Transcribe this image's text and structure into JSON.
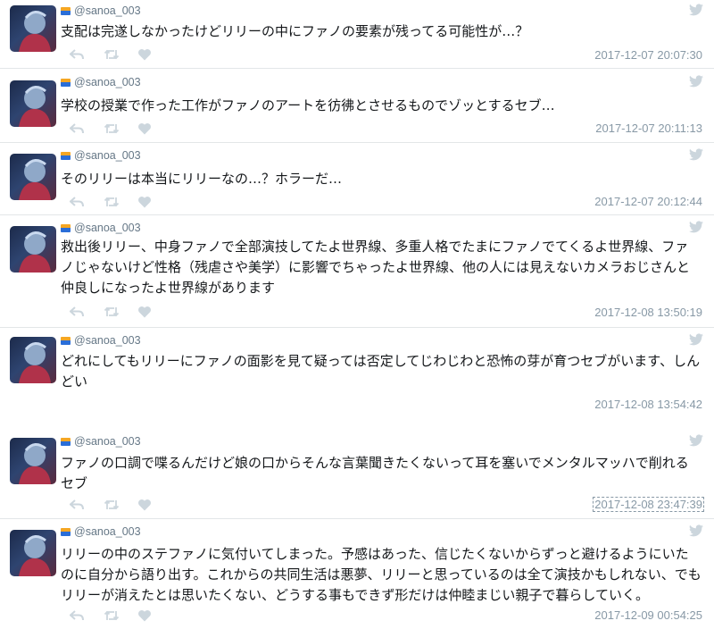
{
  "tweets": [
    {
      "handle": "@sanoa_003",
      "text": "支配は完遂しなかったけどリリーの中にファノの要素が残ってる可能性が…？",
      "timestamp": "2017-12-07 20:07:30"
    },
    {
      "handle": "@sanoa_003",
      "text": "学校の授業で作った工作がファノのアートを彷彿とさせるものでゾッとするセブ…",
      "timestamp": "2017-12-07 20:11:13"
    },
    {
      "handle": "@sanoa_003",
      "text": "そのリリーは本当にリリーなの…？ホラーだ…",
      "timestamp": "2017-12-07 20:12:44"
    },
    {
      "handle": "@sanoa_003",
      "text": "救出後リリー、中身ファノで全部演技してたよ世界線、多重人格でたまにファノでてくるよ世界線、ファノじゃないけど性格（残虐さや美学）に影響でちゃったよ世界線、他の人には見えないカメラおじさんと仲良しになったよ世界線があります",
      "timestamp": "2017-12-08 13:50:19"
    },
    {
      "handle": "@sanoa_003",
      "text": "どれにしてもリリーにファノの面影を見て疑っては否定してじわじわと恐怖の芽が育つセブがいます、しんどい",
      "timestamp": "2017-12-08 13:54:42"
    },
    {
      "handle": "@sanoa_003",
      "text": "ファノの口調で喋るんだけど娘の口からそんな言葉聞きたくないって耳を塞いでメンタルマッハで削れるセブ",
      "timestamp": "2017-12-08 23:47:39"
    },
    {
      "handle": "@sanoa_003",
      "text": "リリーの中のステファノに気付いてしまった。予感はあった、信じたくないからずっと避けるようにいたのに自分から語り出す。これからの共同生活は悪夢、リリーと思っているのは全て演技かもしれない、でもリリーが消えたとは思いたくない、どうする事もできず形だけは仲睦まじい親子で暮らしていく。",
      "timestamp": "2017-12-09 00:54:25"
    }
  ],
  "colors": {
    "muted": "#8899a6",
    "icon": "#ccd6dd",
    "border": "#e3e6e8"
  }
}
